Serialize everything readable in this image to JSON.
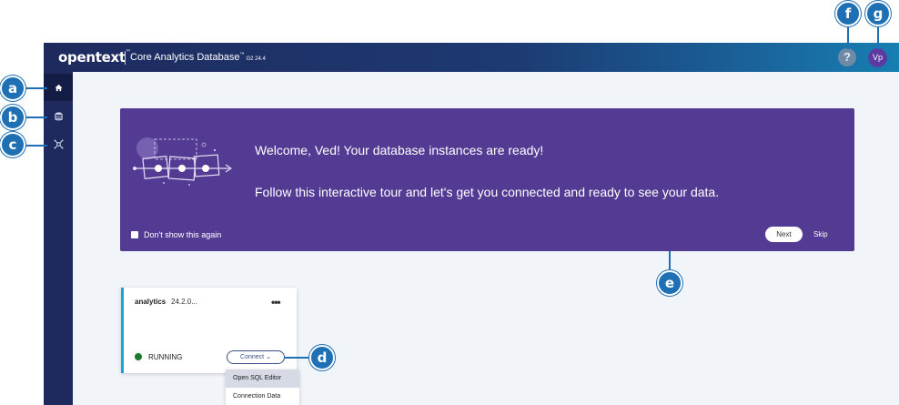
{
  "header": {
    "brand": "opentext",
    "brand_tm": "™",
    "product": "Core Analytics Database",
    "product_tm": "™",
    "product_version": "G2 24.4",
    "help_glyph": "?",
    "avatar_initials": "Vp"
  },
  "sidebar": {
    "items": [
      {
        "icon": "home-icon",
        "active": true
      },
      {
        "icon": "database-icon",
        "active": false
      },
      {
        "icon": "integrations-icon",
        "active": false
      }
    ]
  },
  "banner": {
    "title": "Welcome, Ved! Your database instances are ready!",
    "text": "Follow this interactive tour and let's get you connected and ready to see your data.",
    "dont_show_label": "Don't show this again",
    "next_label": "Next",
    "skip_label": "Skip"
  },
  "instance_card": {
    "name": "analytics",
    "version": "24.2.0...",
    "more_glyph": "•••",
    "status": "RUNNING",
    "status_color": "#1d7a2a",
    "connect_label": "Connect",
    "connect_caret": "⌄"
  },
  "connect_menu": {
    "items": [
      "Open SQL Editor",
      "Connection Data"
    ]
  },
  "callouts": {
    "a": "a",
    "b": "b",
    "c": "c",
    "d": "d",
    "e": "e",
    "f": "f",
    "g": "g"
  },
  "colors": {
    "accent": "#1f6fb4",
    "banner": "#533a93",
    "nav": "#1e2a5e"
  }
}
